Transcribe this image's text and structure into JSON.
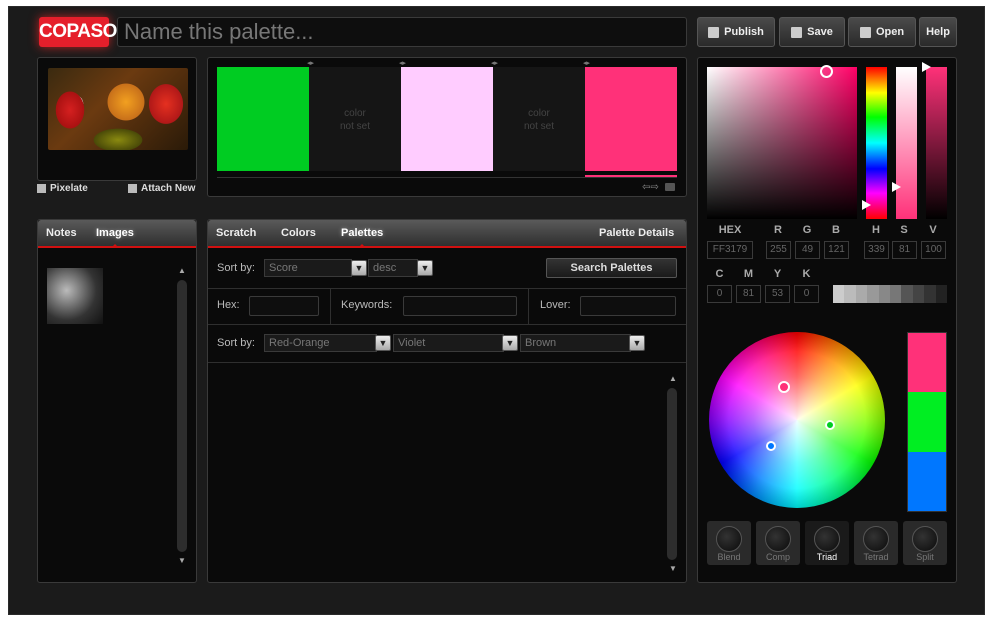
{
  "app": {
    "logo": "COPASO",
    "palette_name_placeholder": "Name this palette..."
  },
  "toolbar": {
    "publish": "Publish",
    "save": "Save",
    "open": "Open",
    "help": "Help"
  },
  "image_panel": {
    "pixelate": "Pixelate",
    "attach_new": "Attach New"
  },
  "palette": {
    "slots": [
      {
        "color": "#00cc22",
        "set": true
      },
      {
        "set": false,
        "text_line1": "color",
        "text_line2": "not set"
      },
      {
        "color": "#ffccff",
        "set": true
      },
      {
        "set": false,
        "text_line1": "color",
        "text_line2": "not set"
      },
      {
        "color": "#ff3179",
        "set": true
      }
    ]
  },
  "left_tabs": {
    "notes": "Notes",
    "images": "Images"
  },
  "main_tabs": {
    "scratch": "Scratch",
    "colors": "Colors",
    "palettes": "Palettes",
    "details": "Palette Details"
  },
  "search": {
    "sort_by_label": "Sort by:",
    "sort_field": "Score",
    "sort_order": "desc",
    "search_button": "Search Palettes",
    "hex_label": "Hex:",
    "keywords_label": "Keywords:",
    "lover_label": "Lover:",
    "sort_by_label2": "Sort by:",
    "hue1": "Red-Orange",
    "hue2": "Violet",
    "hue3": "Brown"
  },
  "color_picker": {
    "labels": {
      "hex": "HEX",
      "r": "R",
      "g": "G",
      "b": "B",
      "h": "H",
      "s": "S",
      "v": "V",
      "c": "C",
      "m": "M",
      "y": "Y",
      "k": "K"
    },
    "values": {
      "hex": "FF3179",
      "r": "255",
      "g": "49",
      "b": "121",
      "h": "339",
      "s": "81",
      "v": "100",
      "c": "0",
      "m": "81",
      "y": "53",
      "k": "0"
    },
    "accent": "#ff3179"
  },
  "harmony": {
    "blend": "Blend",
    "comp": "Comp",
    "triad": "Triad",
    "tetrad": "Tetrad",
    "split": "Split",
    "active": "Triad",
    "swatches": [
      "#ff3179",
      "#00ee22",
      "#0077ff"
    ]
  }
}
